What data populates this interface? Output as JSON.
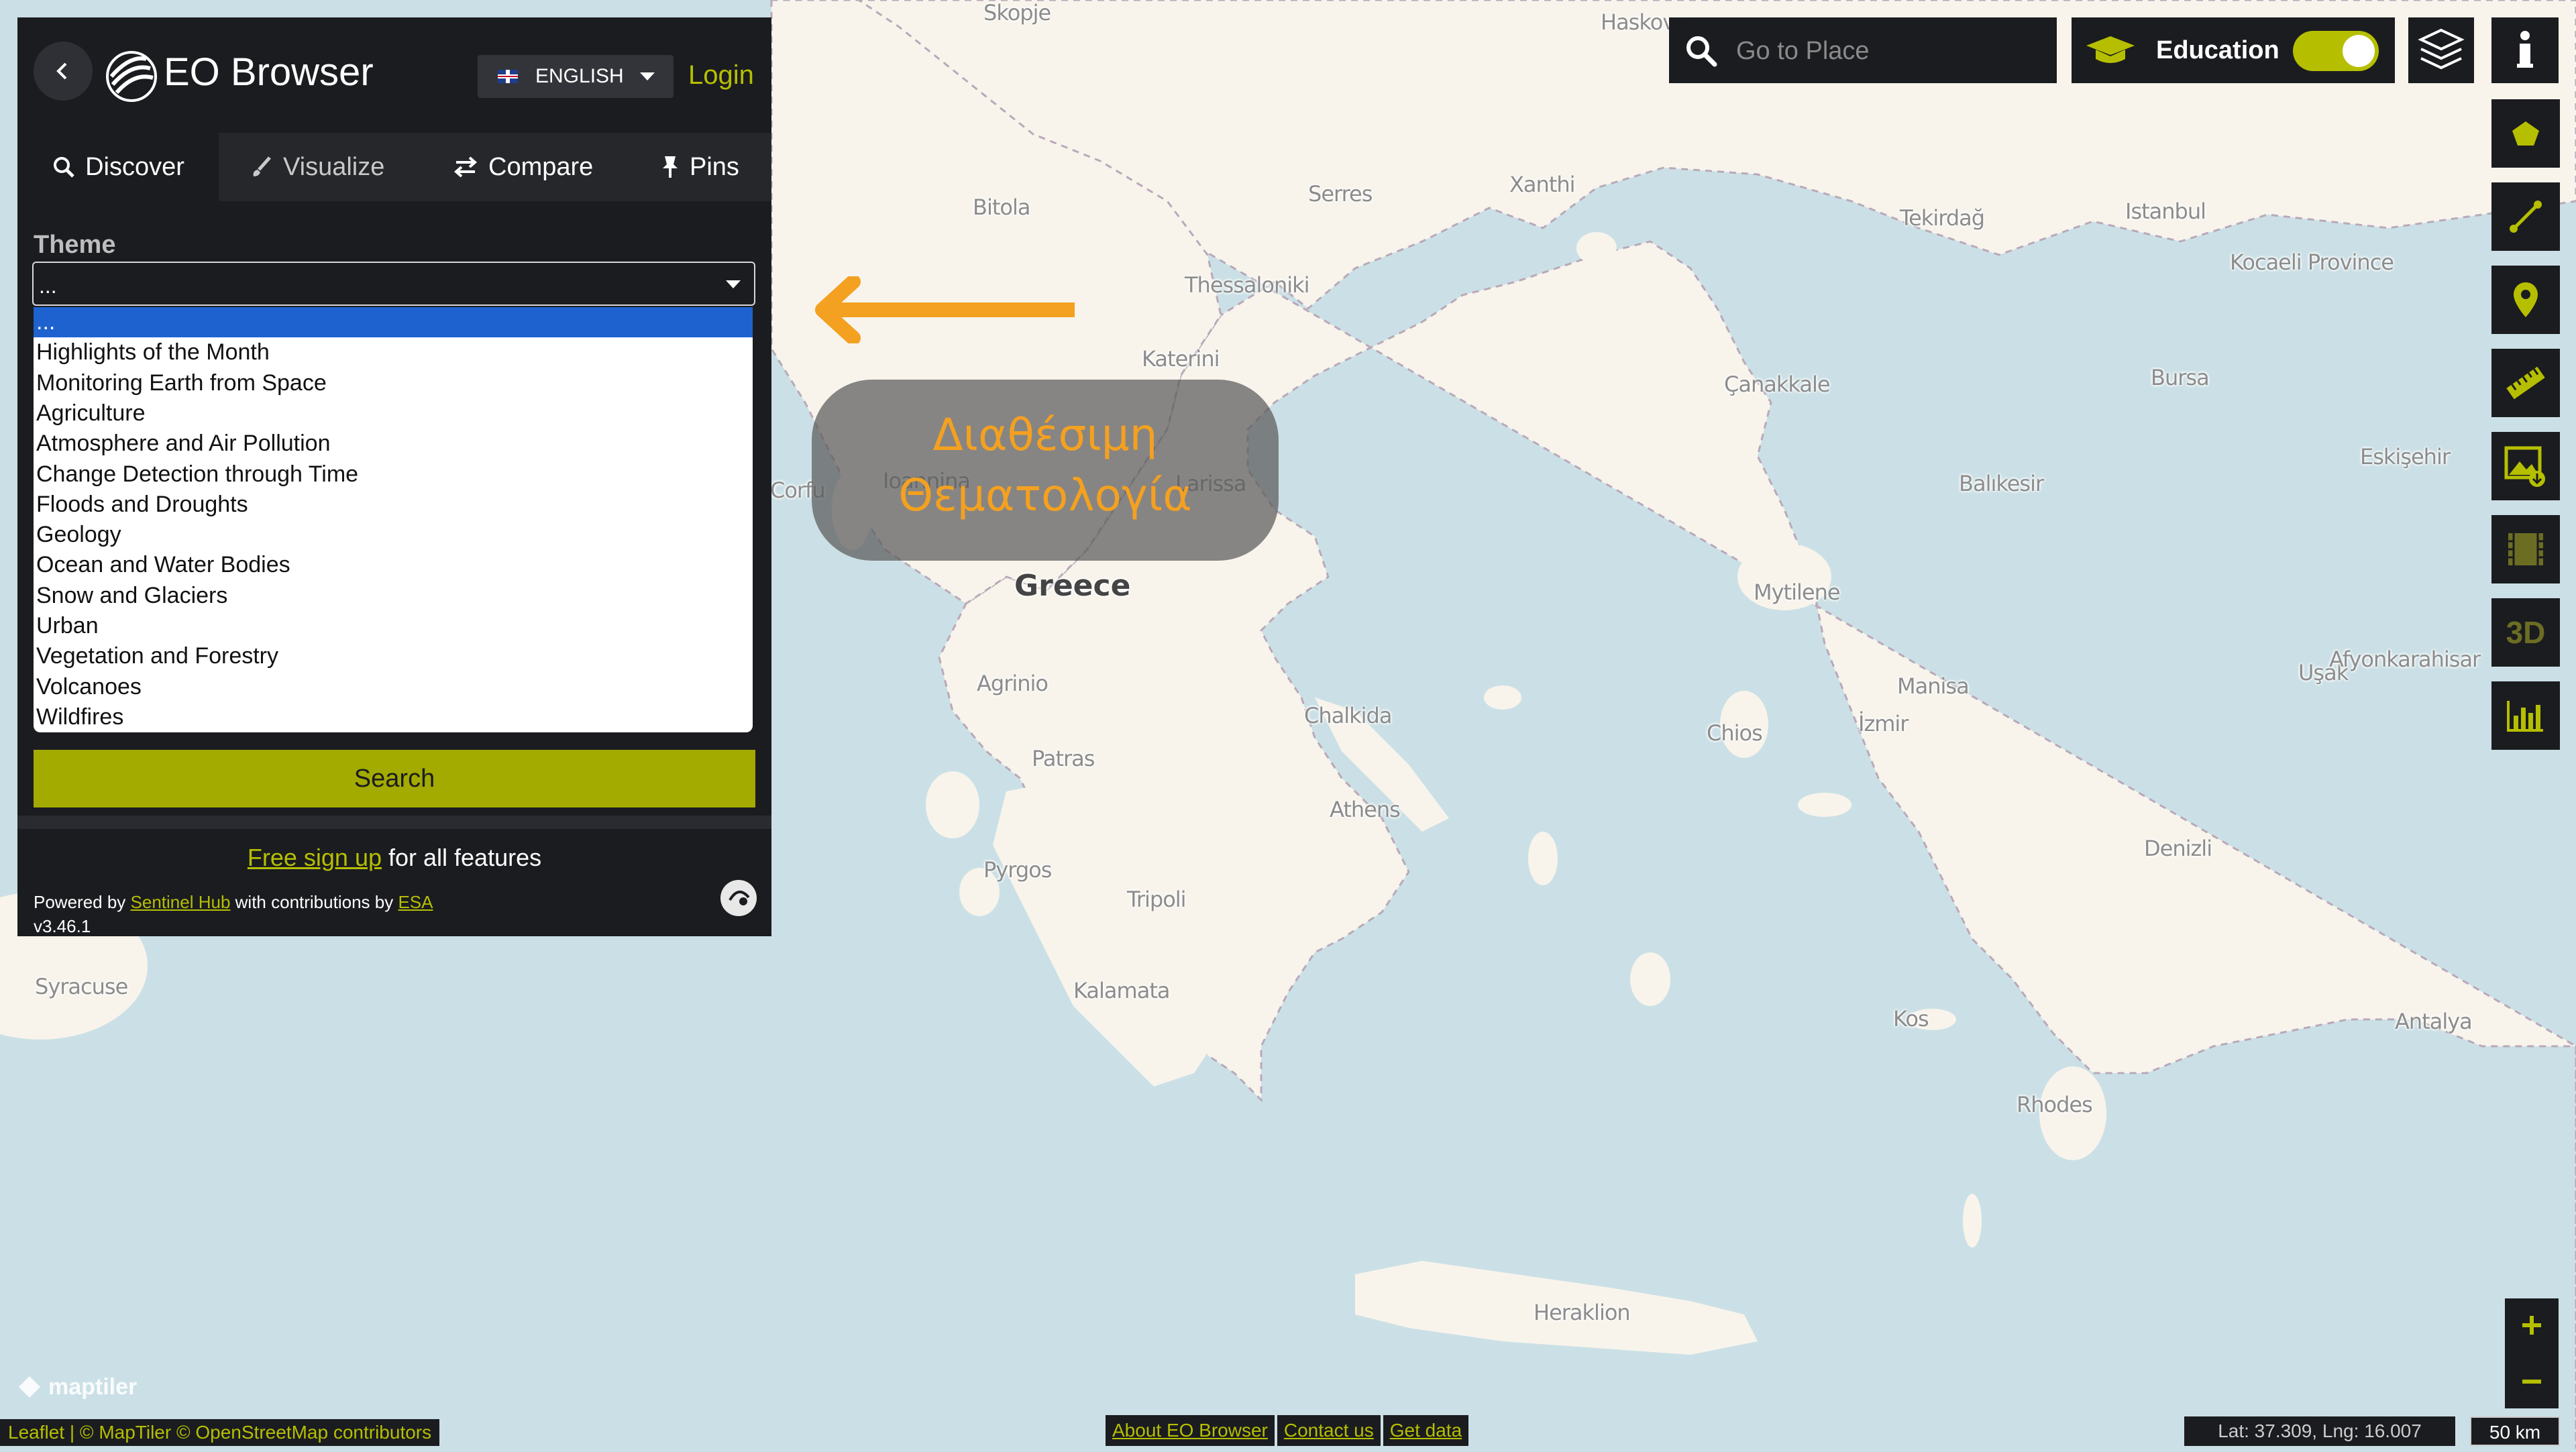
{
  "header": {
    "app_title": "EO Browser",
    "language": "ENGLISH",
    "login": "Login"
  },
  "tabs": [
    {
      "label": "Discover",
      "icon": "search-icon"
    },
    {
      "label": "Visualize",
      "icon": "brush-icon"
    },
    {
      "label": "Compare",
      "icon": "compare-arrows-icon"
    },
    {
      "label": "Pins",
      "icon": "pin-icon"
    }
  ],
  "theme": {
    "label": "Theme",
    "selected_value": "...",
    "options": [
      "...",
      "Highlights of the Month",
      "Monitoring Earth from Space",
      "Agriculture",
      "Atmosphere and Air Pollution",
      "Change Detection through Time",
      "Floods and Droughts",
      "Geology",
      "Ocean and Water Bodies",
      "Snow and Glaciers",
      "Urban",
      "Vegetation and Forestry",
      "Volcanoes",
      "Wildfires"
    ]
  },
  "search_button": "Search",
  "footer": {
    "signup_link": "Free sign up",
    "signup_rest": " for all features",
    "powered_prefix": "Powered by ",
    "sentinel_hub": "Sentinel Hub",
    "with_contrib": " with contributions by ",
    "esa": "ESA",
    "version": "v3.46.1"
  },
  "overlay": {
    "line1": "Διαθέσιμη",
    "line2": "Θεματολογία"
  },
  "goto": {
    "placeholder": "Go to Place"
  },
  "education": {
    "label": "Education",
    "enabled": true
  },
  "map_labels": [
    {
      "name": "Skopje",
      "country": false
    },
    {
      "name": "Haskovo",
      "country": false
    },
    {
      "name": "Bitola",
      "country": false
    },
    {
      "name": "Serres",
      "country": false
    },
    {
      "name": "Xanthi",
      "country": false
    },
    {
      "name": "Tekirdağ",
      "country": false
    },
    {
      "name": "Istanbul",
      "country": false
    },
    {
      "name": "Kocaeli Province",
      "country": false
    },
    {
      "name": "Thessaloniki",
      "country": false
    },
    {
      "name": "Katerini",
      "country": false
    },
    {
      "name": "Çanakkale",
      "country": false
    },
    {
      "name": "Bursa",
      "country": false
    },
    {
      "name": "Ioannina",
      "country": false
    },
    {
      "name": "Larissa",
      "country": false
    },
    {
      "name": "Corfu",
      "country": false
    },
    {
      "name": "Balıkesir",
      "country": false
    },
    {
      "name": "Eskişehir",
      "country": false
    },
    {
      "name": "Greece",
      "country": true
    },
    {
      "name": "Mytilene",
      "country": false
    },
    {
      "name": "Agrinio",
      "country": false
    },
    {
      "name": "Manisa",
      "country": false
    },
    {
      "name": "Uşak",
      "country": false
    },
    {
      "name": "Afyonkarahisar",
      "country": false
    },
    {
      "name": "Chalkida",
      "country": false
    },
    {
      "name": "İzmir",
      "country": false
    },
    {
      "name": "Chios",
      "country": false
    },
    {
      "name": "Patras",
      "country": false
    },
    {
      "name": "Athens",
      "country": false
    },
    {
      "name": "Denizli",
      "country": false
    },
    {
      "name": "Pyrgos",
      "country": false
    },
    {
      "name": "Tripoli",
      "country": false
    },
    {
      "name": "Syracuse",
      "country": false
    },
    {
      "name": "Kalamata",
      "country": false
    },
    {
      "name": "Kos",
      "country": false
    },
    {
      "name": "Antalya",
      "country": false
    },
    {
      "name": "Rhodes",
      "country": false
    },
    {
      "name": "Heraklion",
      "country": false
    }
  ],
  "bottom": {
    "leaflet": "Leaflet",
    "attribution": " | © MapTiler © OpenStreetMap contributors",
    "maptiler_logo": "maptiler",
    "about": "About EO Browser",
    "contact": "Contact us",
    "get_data": "Get data",
    "coords": "Lat: 37.309, Lng: 16.007",
    "scale": "50 km"
  },
  "right_toolbar": [
    "info-icon",
    "polygon-icon",
    "line-measure-icon",
    "location-pin-icon",
    "ruler-icon",
    "image-download-icon",
    "timelapse-film-icon",
    "3d-icon",
    "histogram-chart-icon"
  ],
  "right_toolbar_3d_text": "3D",
  "colors": {
    "accent": "#b5bf00",
    "panel_bg": "#1b1c20",
    "sea": "#cbe0e6",
    "land": "#f8f4ec",
    "overlay_text": "#f4a020",
    "selected_option": "#1e62d0"
  }
}
